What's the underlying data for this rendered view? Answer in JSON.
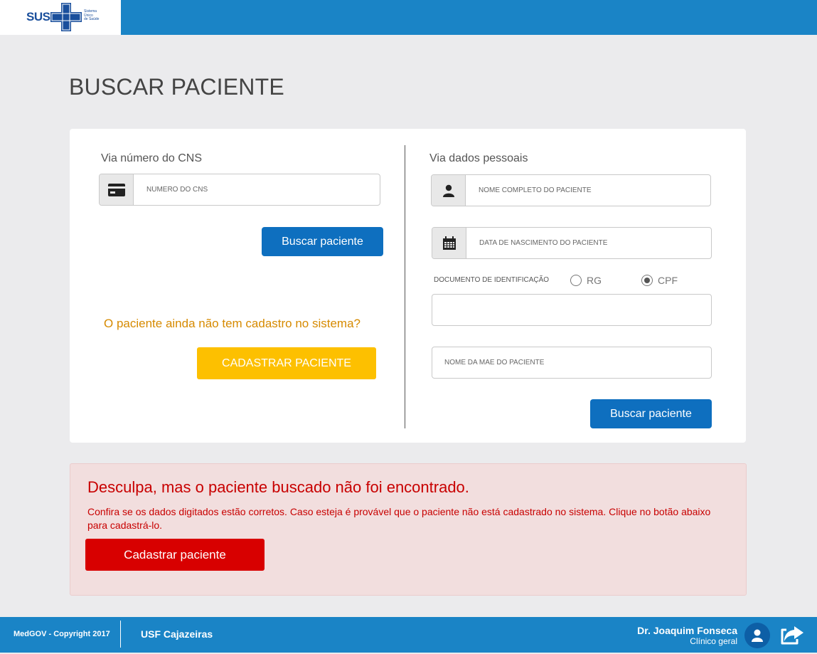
{
  "header": {
    "logo_name": "SUS",
    "logo_subtitle_lines": [
      "Sistema",
      "Único",
      "de Saúde"
    ],
    "bar_color": "#1a84c6"
  },
  "page": {
    "title": "BUSCAR PACIENTE"
  },
  "cns_section": {
    "label": "Via número do CNS",
    "input_placeholder": "NÚMERO DO CNS",
    "search_button": "Buscar paciente",
    "question": "O paciente ainda não tem cadastro no sistema?",
    "register_button": "CADASTRAR PACIENTE"
  },
  "personal_section": {
    "label": "Via dados pessoais",
    "name_placeholder": "NOME COMPLETO DO PACIENTE",
    "birthdate_placeholder": "DATA DE NASCIMENTO DO PACIENTE",
    "doc_label": "DOCUMENTO DE IDENTIFICAÇÃO",
    "doc_options": [
      {
        "label": "RG",
        "selected": false
      },
      {
        "label": "CPF",
        "selected": true
      }
    ],
    "doc_value": "",
    "mother_placeholder": "NOME DA MÃE DO PACIENTE",
    "search_button": "Buscar paciente"
  },
  "alert": {
    "title": "Desculpa, mas o paciente buscado não foi encontrado.",
    "message": "Confira se os dados digitados estão corretos. Caso esteja é provável que o paciente não está cadastrado no sistema. Clique no botão abaixo para cadastrá-lo.",
    "button": "Cadastrar paciente"
  },
  "footer": {
    "copyright": "MedGOV - Copyright 2017",
    "unit": "USF Cajazeiras",
    "user_name": "Dr. Joaquim Fonseca",
    "user_role": "Clínico geral"
  },
  "colors": {
    "primary": "#0e6fbf",
    "warning": "#fdc000",
    "danger": "#d80000",
    "alert_bg": "#f2dede",
    "question_text": "#d68a00"
  },
  "icons": [
    "sus-cross-logo",
    "id-card-icon",
    "user-icon",
    "calendar-icon",
    "avatar-icon",
    "logout-icon"
  ]
}
